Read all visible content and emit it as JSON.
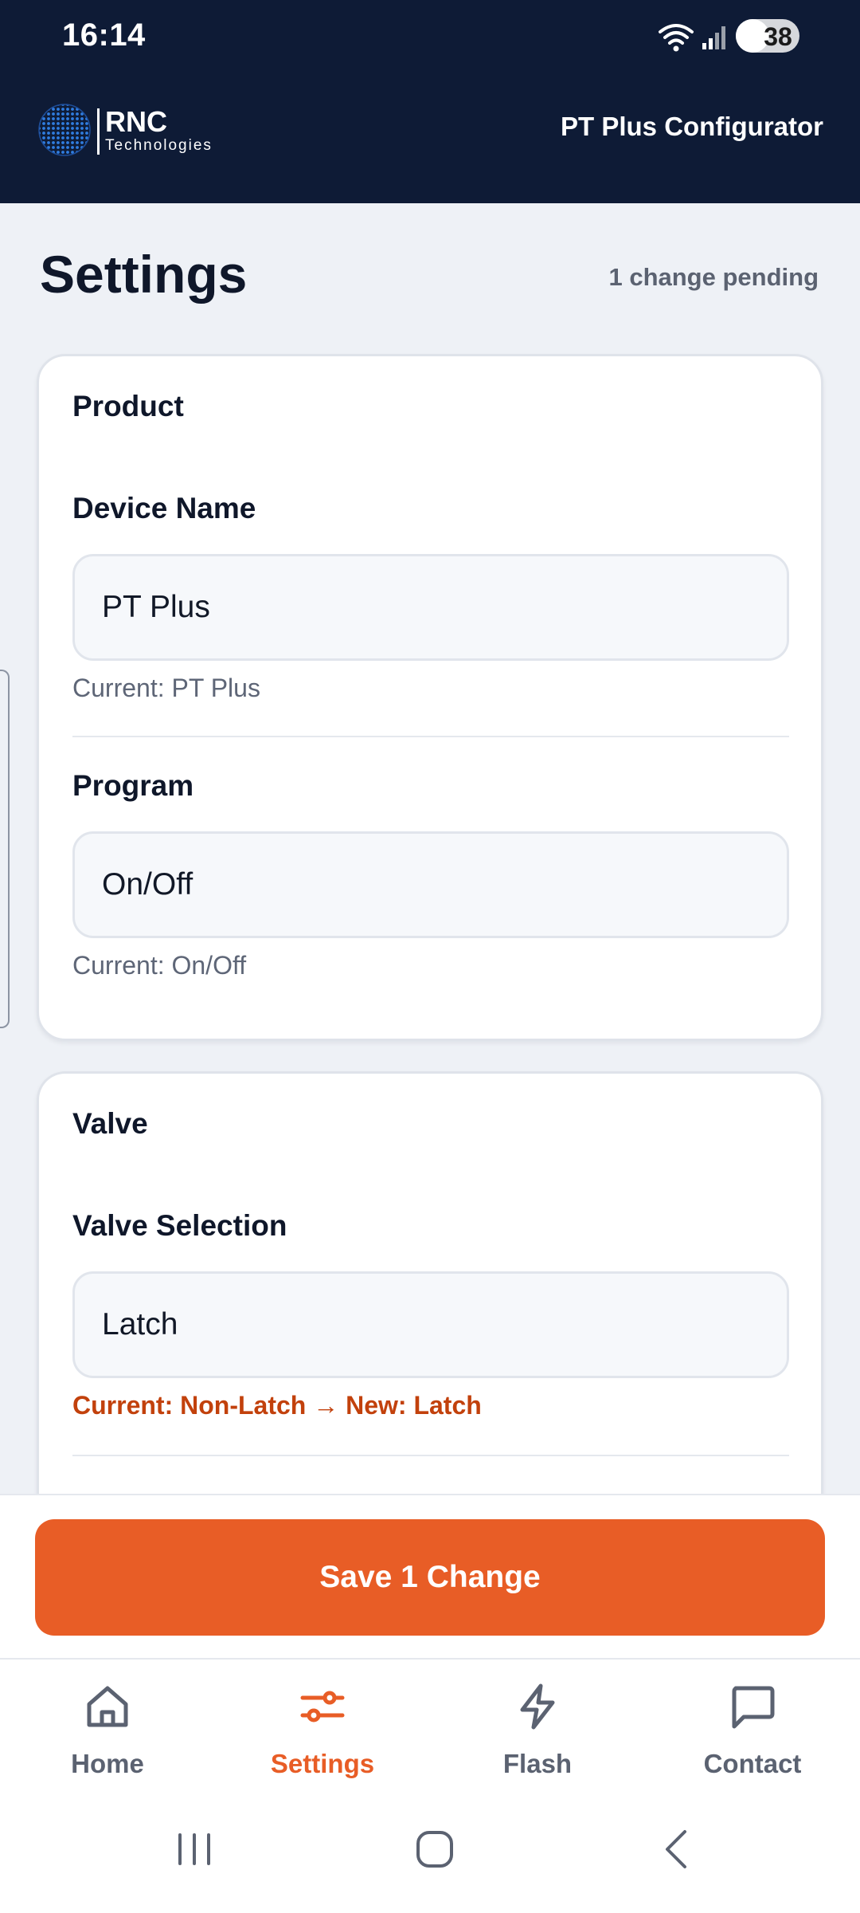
{
  "status_bar": {
    "time": "16:14",
    "battery": "38"
  },
  "header": {
    "brand_name": "RNC",
    "brand_sub": "Technologies",
    "title": "PT Plus Configurator"
  },
  "page": {
    "title": "Settings",
    "pending": "1 change pending"
  },
  "product_section": {
    "title": "Product",
    "device_name": {
      "label": "Device Name",
      "value": "PT Plus",
      "current": "Current: PT Plus"
    },
    "program": {
      "label": "Program",
      "value": "On/Off",
      "current": "Current: On/Off"
    }
  },
  "valve_section": {
    "title": "Valve",
    "valve_selection": {
      "label": "Valve Selection",
      "value": "Latch",
      "change": "Current: Non-Latch → New: Latch"
    }
  },
  "save_button": "Save 1 Change",
  "bottom_nav": {
    "items": [
      {
        "label": "Home",
        "icon": "home-icon"
      },
      {
        "label": "Settings",
        "icon": "sliders-icon",
        "active": true
      },
      {
        "label": "Flash",
        "icon": "lightning-icon"
      },
      {
        "label": "Contact",
        "icon": "chat-bubble-icon"
      }
    ]
  },
  "colors": {
    "header_bg": "#0e1b36",
    "accent": "#e85d26",
    "change_text": "#c2410c",
    "page_bg": "#eef1f6"
  }
}
